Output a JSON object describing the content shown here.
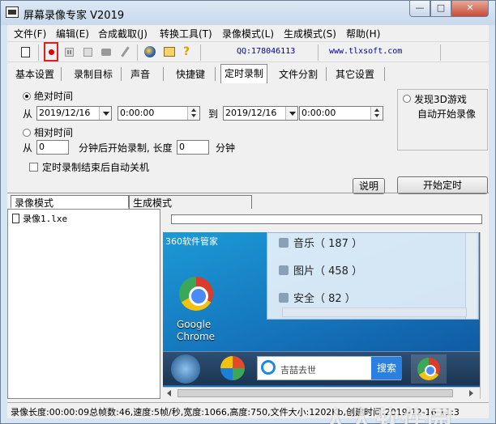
{
  "window": {
    "title": "屏幕录像专家 V2019"
  },
  "menu": [
    "文件(F)",
    "编辑(E)",
    "合成截取(J)",
    "转换工具(T)",
    "录像模式(L)",
    "生成模式(S)",
    "帮助(H)"
  ],
  "toolbar": {
    "qq": "QQ:178046113",
    "website": "www.tlxsoft.com"
  },
  "tabs": [
    "基本设置",
    "录制目标",
    "声音",
    "快捷键",
    "定时录制",
    "文件分割",
    "其它设置"
  ],
  "active_tab": "定时录制",
  "schedule": {
    "absolute_label": "绝对时间",
    "from_label": "从",
    "start_date": "2019/12/16",
    "start_time": "0:00:00",
    "to_label": "到",
    "end_date": "2019/12/16",
    "end_time": "0:00:00",
    "relative_label": "相对时间",
    "relative_from_label": "从",
    "relative_start": "0",
    "minutes_after_label": "分钟后开始录制, 长度",
    "relative_length": "0",
    "minutes_label": "分钟",
    "shutdown_label": "定时录制结束后自动关机",
    "explain_button": "说明",
    "game_label_1": "发现3D游戏",
    "game_label_2": "自动开始录像",
    "start_button": "开始定时"
  },
  "mode_tabs": [
    "录像模式",
    "生成模式"
  ],
  "file_list": [
    "录像1.lxe"
  ],
  "preview": {
    "title": "360软件管家",
    "rows": [
      "音乐（ 187 ）",
      "图片（ 458 ）",
      "安全（ 82 ）"
    ],
    "chrome_label_1": "Google",
    "chrome_label_2": "Chrome",
    "search_placeholder": "吉喆去世",
    "search_button": "搜索"
  },
  "status": "录像长度:00:00:09总帧数:46,速度:5帧/秒,宽度:1066,高度:750,文件大小:1202Kb,创建时间:2019-12-16 11:3",
  "watermark": "人人软件园"
}
